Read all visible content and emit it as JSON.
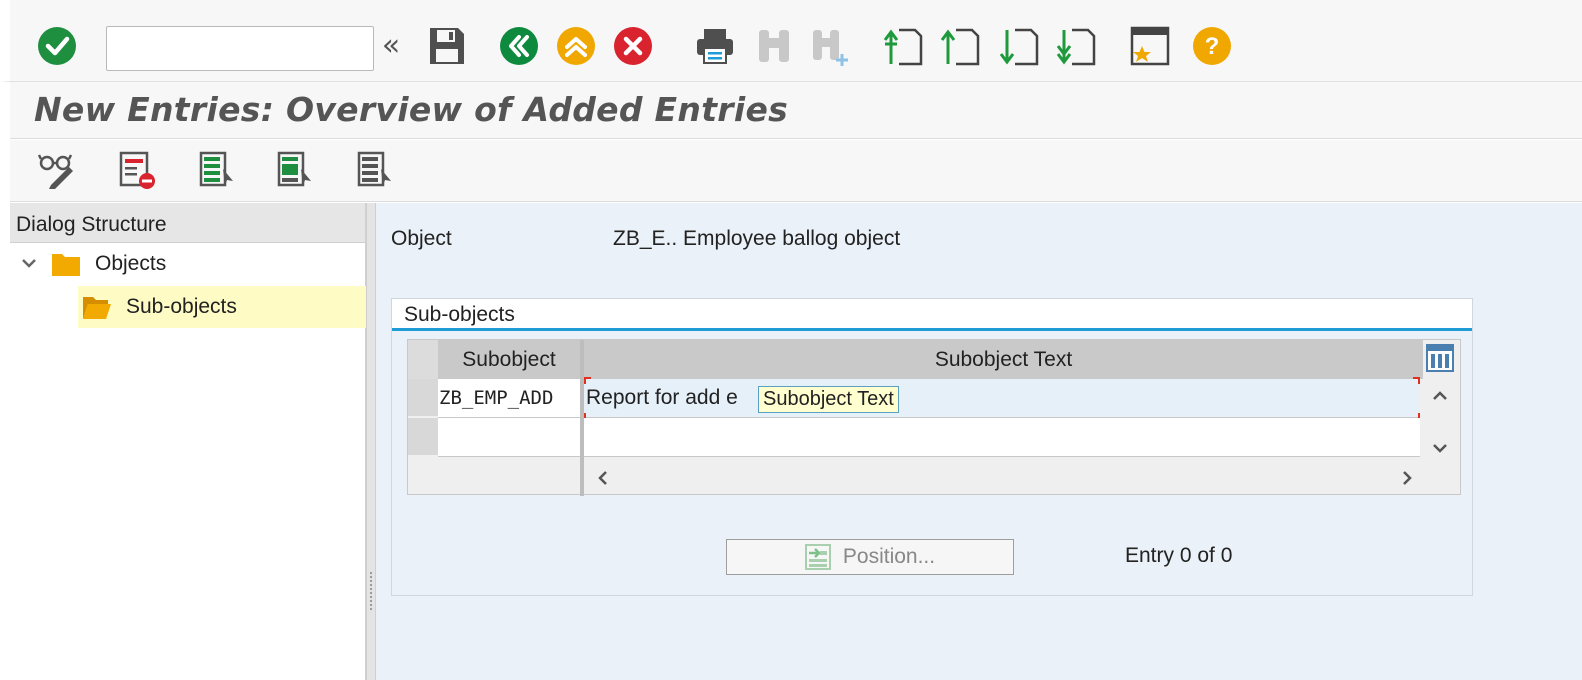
{
  "toolbar": {
    "command_field_value": "",
    "icons": [
      "enter-icon",
      "back-double-icon",
      "save-icon",
      "back-icon",
      "exit-icon",
      "cancel-icon",
      "print-icon",
      "find-icon",
      "find-next-icon",
      "first-page-icon",
      "previous-page-icon",
      "next-page-icon",
      "last-page-icon",
      "bookmark-icon",
      "help-icon"
    ]
  },
  "title": "New Entries: Overview of Added Entries",
  "app_toolbar": {
    "icons": [
      "display-change-icon",
      "delete-icon",
      "select-all-icon",
      "select-block-icon",
      "deselect-all-icon"
    ]
  },
  "dialog_structure": {
    "header": "Dialog Structure",
    "nodes": [
      {
        "label": "Objects",
        "expanded": true
      },
      {
        "label": "Sub-objects",
        "selected": true
      }
    ]
  },
  "object": {
    "label": "Object",
    "value": "ZB_E.. Employee ballog object"
  },
  "subobjects_group": {
    "title": "Sub-objects",
    "columns": [
      "Subobject",
      "Subobject Text"
    ],
    "rows": [
      {
        "subobject": "ZB_EMP_ADD",
        "text": "Report for add e"
      },
      {
        "subobject": "",
        "text": ""
      }
    ],
    "tooltip": "Subobject Text",
    "position_button": "Position...",
    "entry_count": "Entry 0 of 0"
  },
  "colors": {
    "enter_green": "#1e8f3e",
    "nav_green": "#0e8a3e",
    "exit_orange": "#f0a800",
    "cancel_red": "#d9232e",
    "help_orange": "#f0a800",
    "group_accent": "#1f9cd6"
  }
}
